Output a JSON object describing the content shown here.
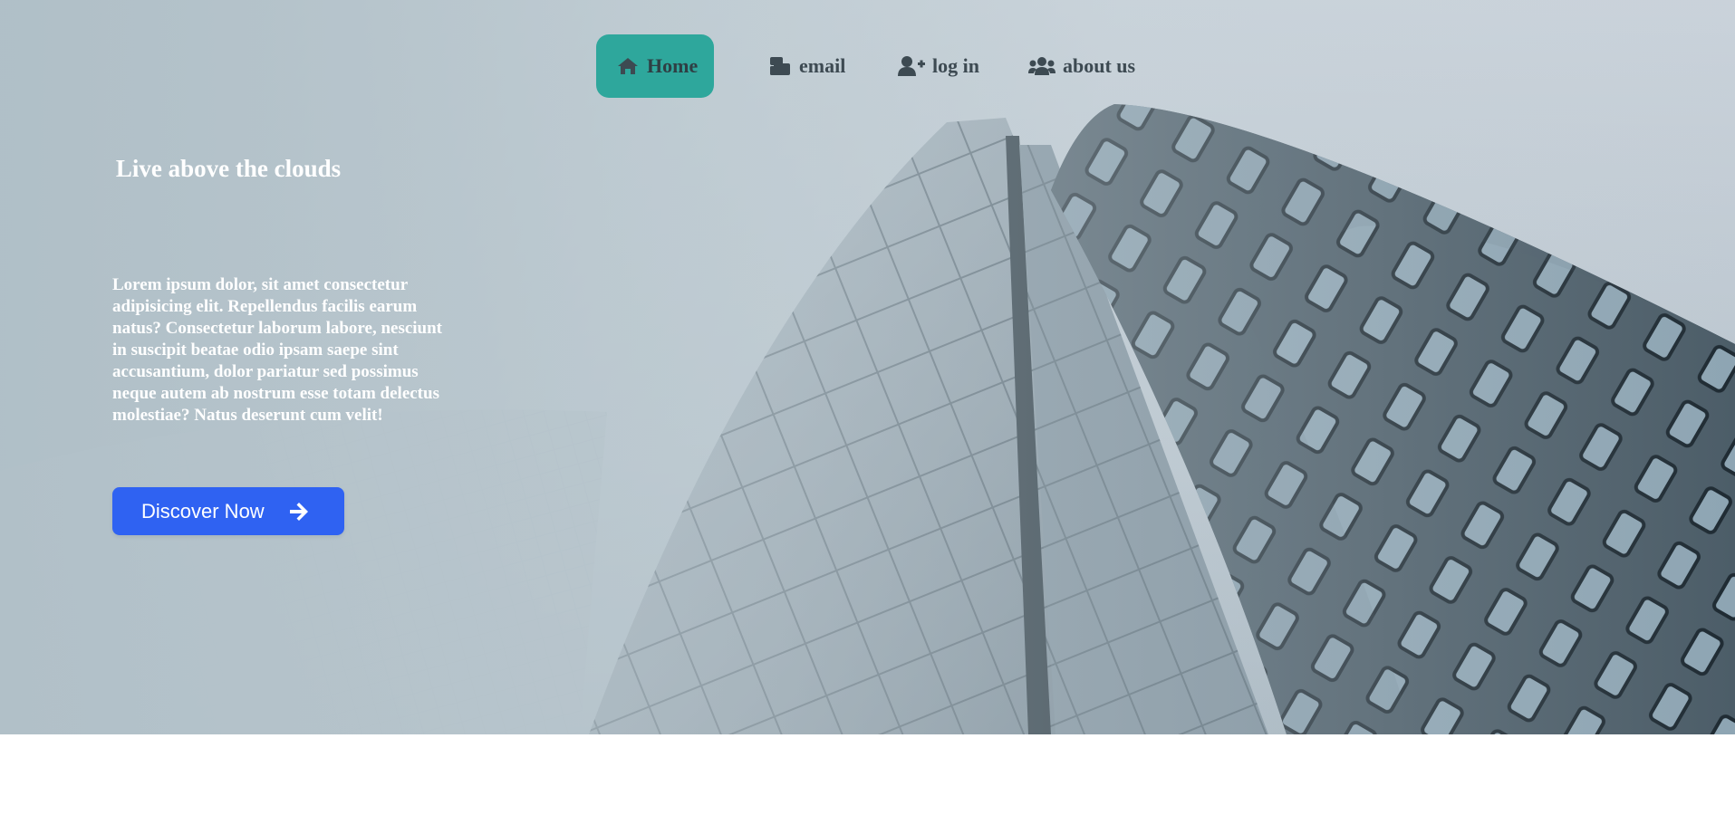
{
  "nav": {
    "items": [
      {
        "label": "Home",
        "icon": "home-icon",
        "active": true
      },
      {
        "label": "email",
        "icon": "mail-bulk-icon",
        "active": false
      },
      {
        "label": "log in",
        "icon": "user-plus-icon",
        "active": false
      },
      {
        "label": "about us",
        "icon": "users-icon",
        "active": false
      }
    ]
  },
  "hero": {
    "headline": "Live above the clouds",
    "body": "Lorem ipsum dolor, sit amet consectetur adipisicing elit. Repellendus facilis earum natus? Consectetur laborum labore, nesciunt in suscipit beatae odio ipsam saepe sint accusantium, dolor pariatur sed possimus neque autem ab nostrum esse totam delectus molestiae? Natus deserunt cum velit!",
    "cta_label": "Discover Now",
    "cta_icon": "arrow-right-icon"
  },
  "colors": {
    "nav_active_bg": "#2ea79c",
    "cta_bg": "#2f62f2",
    "nav_text": "#3d4a52"
  }
}
